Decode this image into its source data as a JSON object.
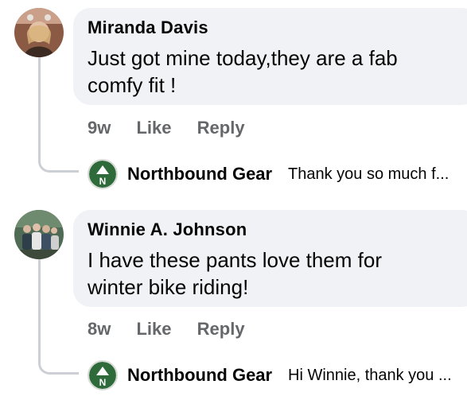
{
  "comments": [
    {
      "author": "Miranda Davis",
      "text": "Just got mine today,they are a fab\ncomfy fit !",
      "time": "9w",
      "like": "Like",
      "reply": "Reply",
      "avatar_icon": "profile-photo",
      "reply_preview": {
        "author": "Northbound Gear",
        "text": "Thank you so much f..."
      }
    },
    {
      "author": "Winnie A. Johnson",
      "text": "I have these pants love them for\nwinter bike riding!",
      "time": "8w",
      "like": "Like",
      "reply": "Reply",
      "avatar_icon": "group-photo",
      "reply_preview": {
        "author": "Northbound Gear",
        "text": "Hi Winnie, thank you ..."
      }
    }
  ],
  "colors": {
    "bubble": "#f0f2f5",
    "meta_text": "#65676b",
    "brand_green": "#2f6b3a",
    "thread_line": "#ccd0d5"
  }
}
